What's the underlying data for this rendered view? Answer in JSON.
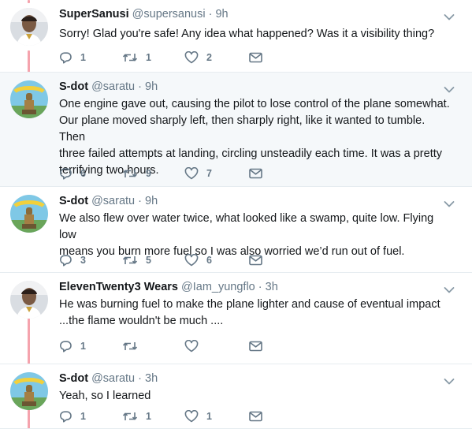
{
  "tweets": [
    {
      "name": "SuperSanusi",
      "handle": "@supersanusi",
      "time": "9h",
      "text": [
        "Sorry! Glad you're safe! Any idea what happened? Was it a visibility thing?"
      ],
      "replies": "1",
      "retweets": "1",
      "likes": "2",
      "avatar": "portrait-avatar"
    },
    {
      "name": "S-dot",
      "handle": "@saratu",
      "time": "9h",
      "text": [
        "One engine gave out, causing the pilot to lose control of the plane somewhat.",
        "Our plane moved sharply left, then sharply right, like it wanted to tumble. Then",
        "three failed attempts at landing, circling unsteadily each time. It was a pretty",
        "terrifying two hours."
      ],
      "replies": "6",
      "retweets": "9",
      "likes": "7",
      "avatar": "statue-avatar"
    },
    {
      "name": "S-dot",
      "handle": "@saratu",
      "time": "9h",
      "text": [
        "We also flew over water twice, what looked like a swamp, quite low. Flying low",
        "means you burn more fuel so I was also worried we’d run out of fuel."
      ],
      "replies": "3",
      "retweets": "5",
      "likes": "6",
      "avatar": "statue-avatar"
    },
    {
      "name": "ElevenTwenty3 Wears",
      "handle": "@Iam_yungflo",
      "time": "3h",
      "text": [
        "He was burning fuel to make the plane lighter and cause of eventual impact",
        "...the flame wouldn't be much ...."
      ],
      "replies": "1",
      "retweets": "",
      "likes": "",
      "avatar": "portrait-avatar"
    },
    {
      "name": "S-dot",
      "handle": "@saratu",
      "time": "3h",
      "text": [
        "Yeah, so I learned"
      ],
      "replies": "1",
      "retweets": "1",
      "likes": "1",
      "avatar": "statue-avatar"
    }
  ],
  "separator": "·",
  "colors": {
    "thread_line": "#f5a3ad",
    "highlight_bg": "#f5f8fa",
    "secondary_text": "#657786",
    "divider": "#e6ecf0"
  },
  "icons": {
    "reply": "reply-icon",
    "retweet": "retweet-icon",
    "like": "heart-icon",
    "dm": "envelope-icon",
    "menu": "chevron-down-icon"
  }
}
